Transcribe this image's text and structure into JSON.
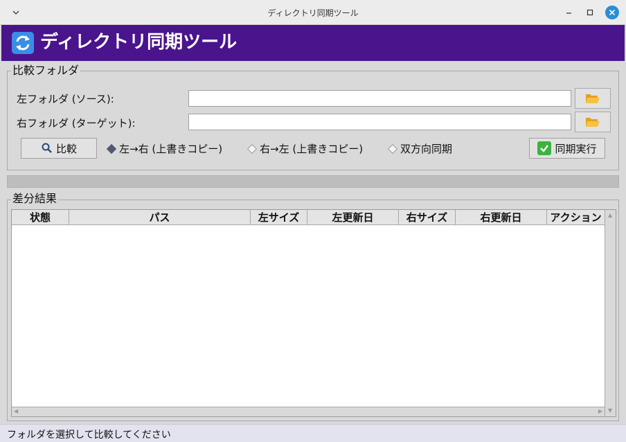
{
  "window": {
    "title": "ディレクトリ同期ツール"
  },
  "header": {
    "title": "ディレクトリ同期ツール"
  },
  "compare_group": {
    "legend": "比較フォルダ",
    "left_label": "左フォルダ (ソース):",
    "left_value": "",
    "right_label": "右フォルダ (ターゲット):",
    "right_value": "",
    "compare_button": "比較",
    "modes": [
      {
        "label": "左→右 (上書きコピー)",
        "selected": true
      },
      {
        "label": "右→左 (上書きコピー)",
        "selected": false
      },
      {
        "label": "双方向同期",
        "selected": false
      }
    ],
    "sync_button": "同期実行"
  },
  "progress": {
    "value": 0
  },
  "diff_group": {
    "legend": "差分結果",
    "columns": [
      "状態",
      "パス",
      "左サイズ",
      "左更新日",
      "右サイズ",
      "右更新日",
      "アクション"
    ],
    "rows": []
  },
  "status": {
    "text": "フォルダを選択して比較してください"
  },
  "colors": {
    "header_bg": "#4a148c",
    "close_button": "#2a8dd6",
    "sync_check": "#3db33d"
  },
  "icons": {
    "app": "sync-arrows-icon",
    "browse": "folder-open-icon",
    "compare": "magnifier-icon",
    "sync": "check-mark-icon"
  }
}
